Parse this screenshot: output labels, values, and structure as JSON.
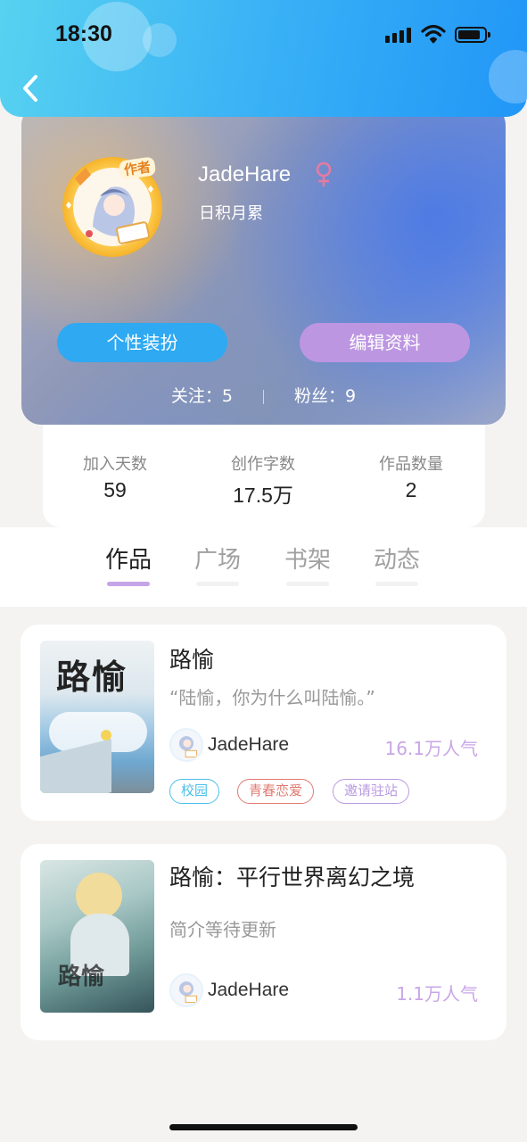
{
  "status_bar": {
    "time": "18:30"
  },
  "profile": {
    "nickname": "JadeHare",
    "gender_symbol": "♀",
    "signature": "日积月累",
    "avatar_badge": "作者",
    "buttons": {
      "dressup": "个性装扮",
      "edit": "编辑资料"
    },
    "following_label": "关注：5",
    "followers_label": "粉丝：9"
  },
  "stats": [
    {
      "label": "加入天数",
      "value": "59"
    },
    {
      "label": "创作字数",
      "value": "17.5万"
    },
    {
      "label": "作品数量",
      "value": "2"
    }
  ],
  "tabs": [
    {
      "label": "作品",
      "active": true
    },
    {
      "label": "广场",
      "active": false
    },
    {
      "label": "书架",
      "active": false
    },
    {
      "label": "动态",
      "active": false
    }
  ],
  "books": [
    {
      "title": "路愉",
      "cover_title": "路愉",
      "description": "“陆愉，你为什么叫陆愉。”",
      "author": "JadeHare",
      "popularity": "16.1万人气",
      "tags": [
        {
          "label": "校园",
          "color": "#4bbfe8"
        },
        {
          "label": "青春恋爱",
          "color": "#e07a72"
        },
        {
          "label": "邀请驻站",
          "color": "#b99ae0"
        }
      ]
    },
    {
      "title": "路愉：平行世界离幻之境",
      "cover_title": "路愉",
      "description": "简介等待更新",
      "author": "JadeHare",
      "popularity": "1.1万人气",
      "tags": []
    }
  ],
  "colors": {
    "header_blue": "#2196f7",
    "button_blue": "#2ea9f2",
    "button_purple": "#bd96e2",
    "tab_indicator": "#c4a5e8",
    "popularity_text": "#c9a6e6"
  }
}
